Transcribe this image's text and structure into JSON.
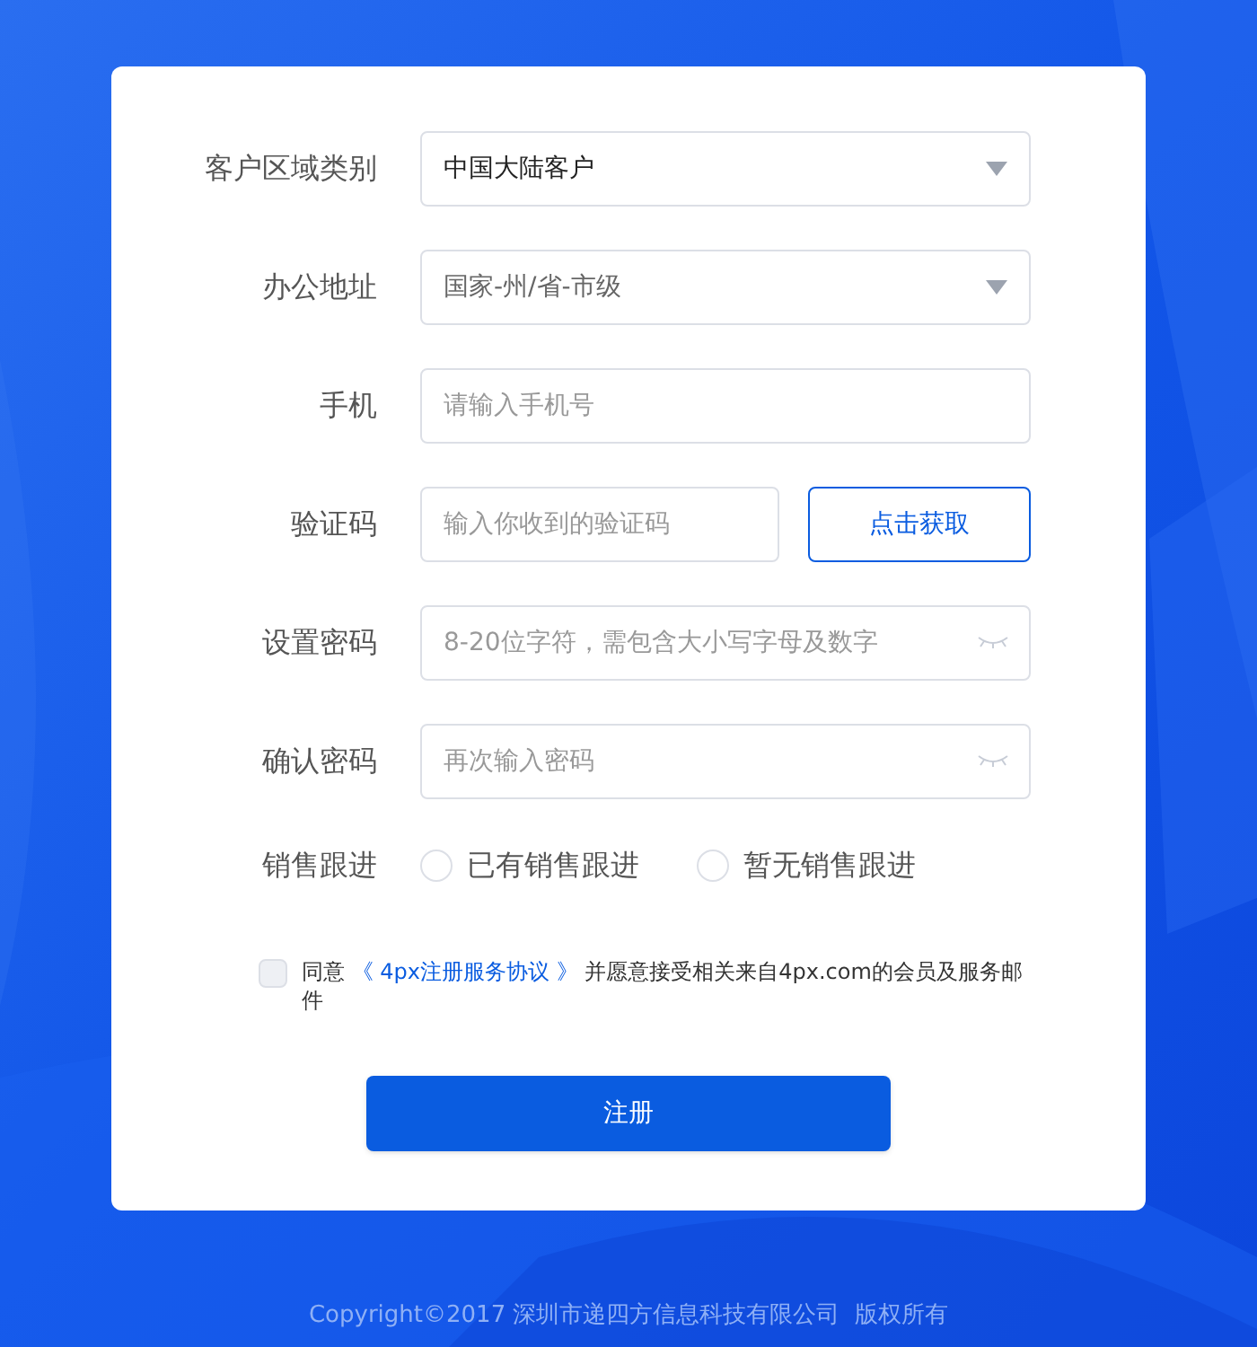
{
  "form": {
    "fields": [
      {
        "kind": "select",
        "label": "客户区域类别",
        "value": "中国大陆客户"
      },
      {
        "kind": "select",
        "label": "办公地址",
        "placeholder": "国家-州/省-市级"
      },
      {
        "kind": "input",
        "label": "手机",
        "placeholder": "请输入手机号"
      },
      {
        "kind": "code",
        "label": "验证码",
        "placeholder": "输入你收到的验证码",
        "button": "点击获取"
      },
      {
        "kind": "password",
        "label": "设置密码",
        "placeholder": "8-20位字符，需包含大小写字母及数字"
      },
      {
        "kind": "password",
        "label": "确认密码",
        "placeholder": "再次输入密码"
      }
    ],
    "sales_follow": {
      "label": "销售跟进",
      "options": [
        {
          "label": "已有销售跟进",
          "selected": false
        },
        {
          "label": "暂无销售跟进",
          "selected": false
        }
      ]
    },
    "agreement": {
      "checked": false,
      "prefix": "同意",
      "link": "《 4px注册服务协议 》",
      "suffix": "并愿意接受相关来自4px.com的会员及服务邮件"
    },
    "submit": "注册"
  },
  "footer": "Copyright©2017 深圳市递四方信息科技有限公司  版权所有"
}
